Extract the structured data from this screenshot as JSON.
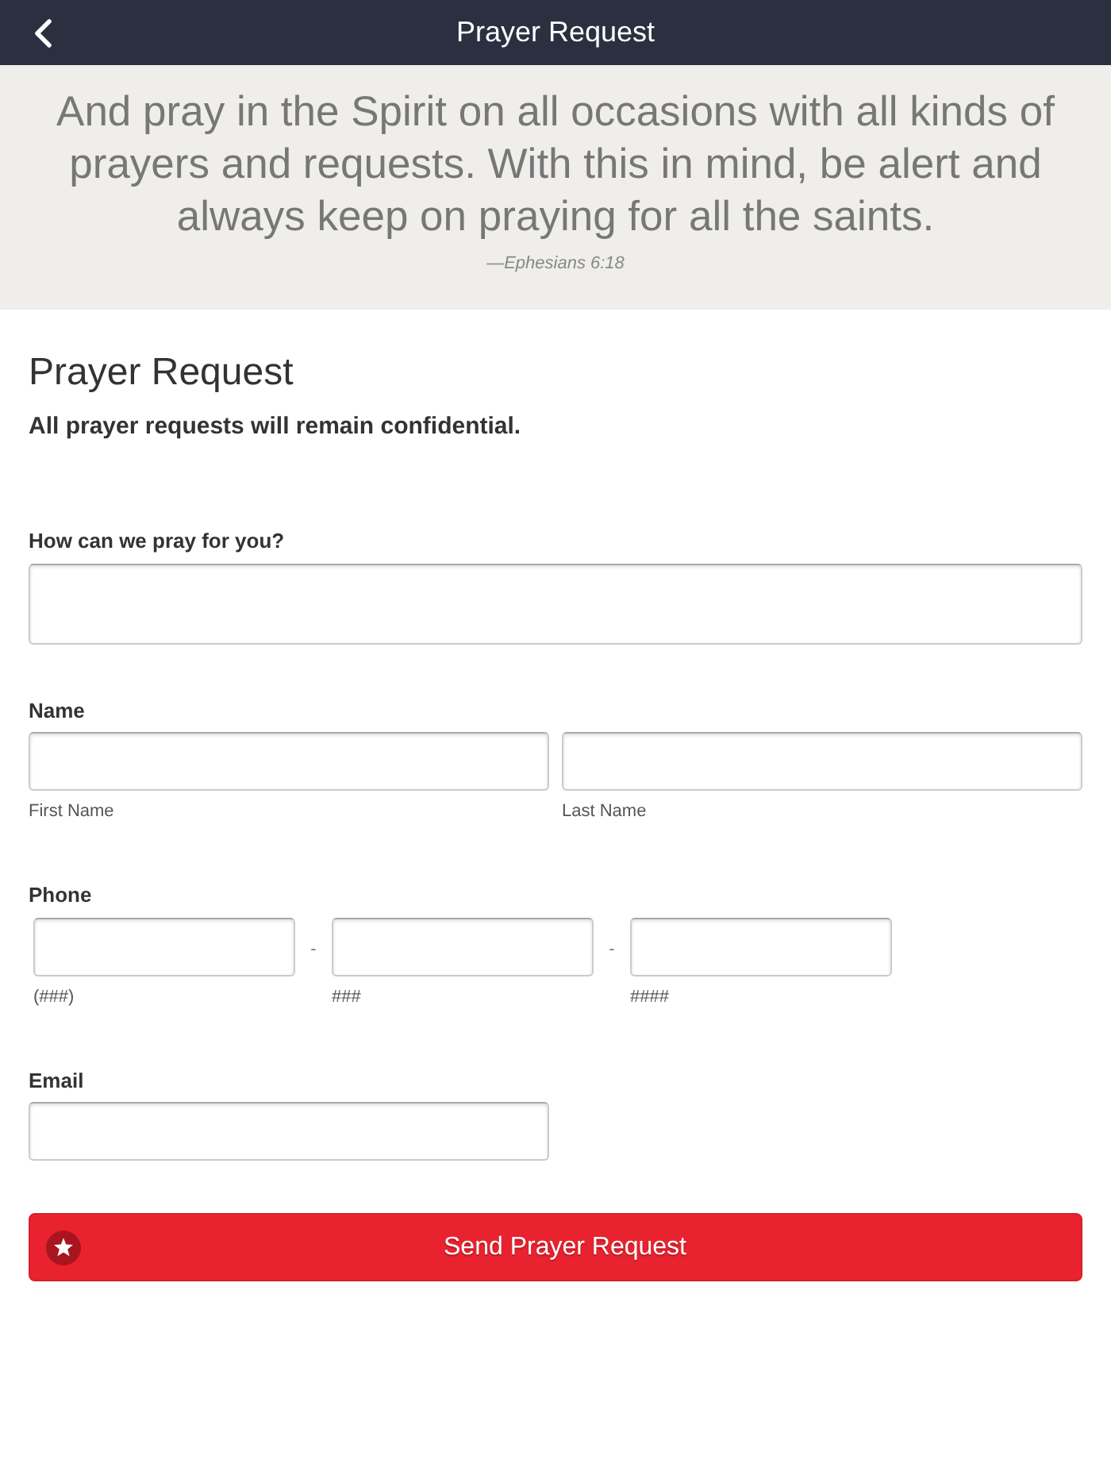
{
  "header": {
    "title": "Prayer Request"
  },
  "banner": {
    "quote": "And pray in the Spirit on all occasions with all kinds of prayers and requests. With this in mind, be alert and always keep on praying for all the saints.",
    "citation": "—Ephesians 6:18"
  },
  "form": {
    "title": "Prayer Request",
    "note": "All prayer requests will remain confidential.",
    "fields": [
      {
        "kind": "textarea",
        "label": "How can we pray for you?"
      },
      {
        "kind": "name",
        "label": "Name",
        "parts": [
          {
            "sublabel": "First Name"
          },
          {
            "sublabel": "Last Name"
          }
        ]
      },
      {
        "kind": "phone",
        "label": "Phone",
        "parts": [
          {
            "sublabel": "(###)"
          },
          {
            "separator": "-",
            "sublabel": "###"
          },
          {
            "separator": "-",
            "sublabel": "####"
          }
        ]
      },
      {
        "kind": "email",
        "label": "Email"
      }
    ],
    "submit": {
      "label": "Send Prayer Request"
    }
  }
}
